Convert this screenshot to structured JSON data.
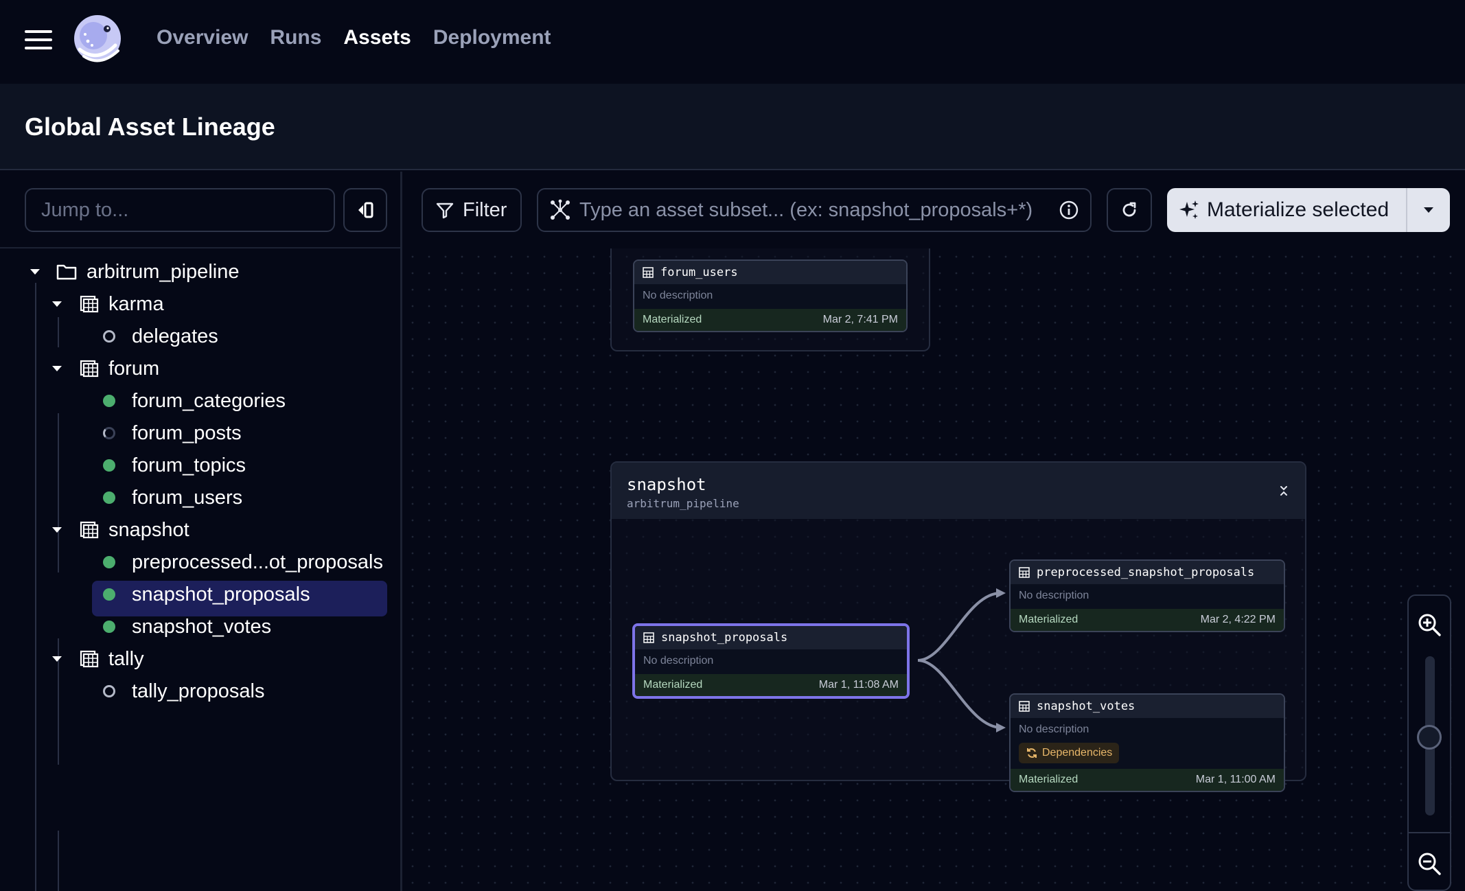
{
  "nav": {
    "links": [
      {
        "label": "Overview",
        "active": false
      },
      {
        "label": "Runs",
        "active": false
      },
      {
        "label": "Assets",
        "active": true
      },
      {
        "label": "Deployment",
        "active": false
      }
    ]
  },
  "header": {
    "title": "Global Asset Lineage"
  },
  "sidebar": {
    "jump_placeholder": "Jump to...",
    "tree": {
      "root": "arbitrum_pipeline",
      "groups": [
        {
          "name": "karma",
          "assets": [
            {
              "name": "delegates",
              "status": "hollow"
            }
          ]
        },
        {
          "name": "forum",
          "assets": [
            {
              "name": "forum_categories",
              "status": "green"
            },
            {
              "name": "forum_posts",
              "status": "spinner"
            },
            {
              "name": "forum_topics",
              "status": "green"
            },
            {
              "name": "forum_users",
              "status": "green"
            }
          ]
        },
        {
          "name": "snapshot",
          "assets": [
            {
              "name": "preprocessed...ot_proposals",
              "status": "green"
            },
            {
              "name": "snapshot_proposals",
              "status": "green",
              "selected": true
            },
            {
              "name": "snapshot_votes",
              "status": "green"
            }
          ]
        },
        {
          "name": "tally",
          "assets": [
            {
              "name": "tally_proposals",
              "status": "hollow"
            }
          ]
        }
      ]
    }
  },
  "toolbar": {
    "filter_label": "Filter",
    "query_placeholder": "Type an asset subset... (ex: snapshot_proposals+*)",
    "materialize_label": "Materialize selected"
  },
  "graph": {
    "forum_node": {
      "name": "forum_users",
      "desc": "No description",
      "status": "Materialized",
      "time": "Mar 2, 7:41 PM"
    },
    "snapshot_group": {
      "title": "snapshot",
      "subtitle": "arbitrum_pipeline"
    },
    "nodes": [
      {
        "name": "snapshot_proposals",
        "desc": "No description",
        "status": "Materialized",
        "time": "Mar 1, 11:08 AM"
      },
      {
        "name": "preprocessed_snapshot_proposals",
        "desc": "No description",
        "status": "Materialized",
        "time": "Mar 2, 4:22 PM"
      },
      {
        "name": "snapshot_votes",
        "desc": "No description",
        "badge": "Dependencies",
        "status": "Materialized",
        "time": "Mar 1, 11:00 AM"
      }
    ]
  },
  "colors": {
    "accent": "#7d74e8",
    "materialized": "#4cae6e",
    "selected_bg": "#1c1f5a",
    "badge": "#e8b76a"
  }
}
